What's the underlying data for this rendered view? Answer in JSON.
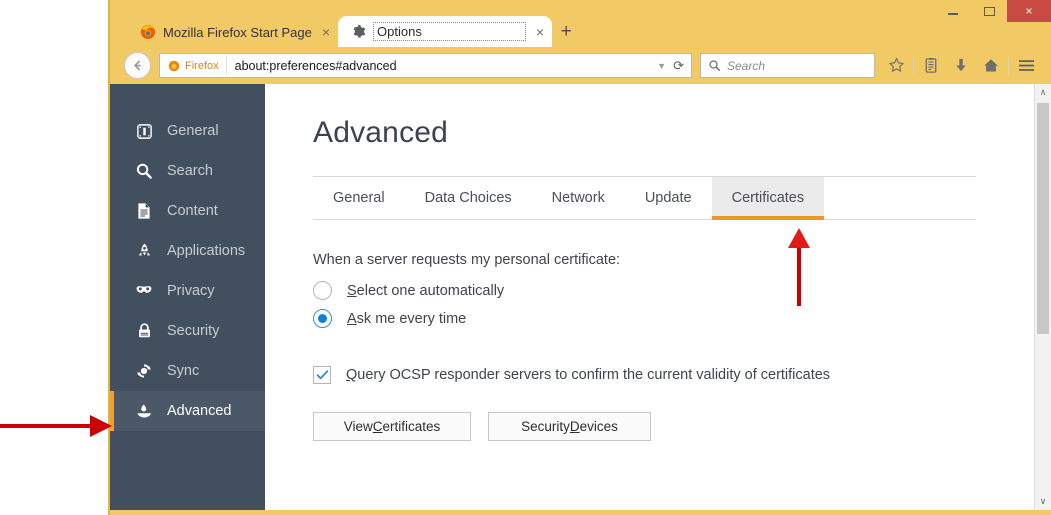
{
  "window": {
    "controls": {
      "minimize_label": "Minimize",
      "maximize_label": "Maximize",
      "close_label": "×"
    }
  },
  "tabs": {
    "items": [
      {
        "title": "Mozilla Firefox Start Page",
        "icon": "firefox-icon",
        "close": "×",
        "active": false
      },
      {
        "title": "Options",
        "icon": "gear-icon",
        "close": "×",
        "active": true
      }
    ],
    "new_tab_label": "+"
  },
  "toolbar": {
    "back_label": "←",
    "identity_label": "Firefox",
    "url": "about:preferences#advanced",
    "dropdown_label": "▼",
    "reload_label": "⟳",
    "search_placeholder": "Search",
    "icons": [
      {
        "name": "bookmark-star-icon",
        "label": "Bookmark"
      },
      {
        "name": "library-icon",
        "label": "Show your bookmarks"
      },
      {
        "name": "downloads-icon",
        "label": "Downloads"
      },
      {
        "name": "home-icon",
        "label": "Home"
      },
      {
        "name": "menu-hamburger-icon",
        "label": "Open menu"
      }
    ]
  },
  "sidebar": {
    "items": [
      {
        "label": "General",
        "icon": "general-panel-icon",
        "selected": false
      },
      {
        "label": "Search",
        "icon": "magnifier-icon",
        "selected": false
      },
      {
        "label": "Content",
        "icon": "document-icon",
        "selected": false
      },
      {
        "label": "Applications",
        "icon": "rocket-icon",
        "selected": false
      },
      {
        "label": "Privacy",
        "icon": "mask-icon",
        "selected": false
      },
      {
        "label": "Security",
        "icon": "padlock-icon",
        "selected": false
      },
      {
        "label": "Sync",
        "icon": "sync-refresh-icon",
        "selected": false
      },
      {
        "label": "Advanced",
        "icon": "flask-icon",
        "selected": true
      }
    ],
    "accent_color": "#f0a030",
    "background_color": "#424f5e"
  },
  "main": {
    "page_title": "Advanced",
    "tabs": [
      {
        "label": "General",
        "selected": false
      },
      {
        "label": "Data Choices",
        "selected": false
      },
      {
        "label": "Network",
        "selected": false
      },
      {
        "label": "Update",
        "selected": false
      },
      {
        "label": "Certificates",
        "selected": true
      }
    ],
    "tab_accent_color": "#e8972a",
    "certificates_pane": {
      "prompt": "When a server requests my personal certificate:",
      "radio_options": [
        {
          "label_pre": "",
          "label_key": "S",
          "label_post": "elect one automatically",
          "selected": false
        },
        {
          "label_pre": "",
          "label_key": "A",
          "label_post": "sk me every time",
          "selected": true
        }
      ],
      "checkbox": {
        "label_key": "Q",
        "label_post": "uery OCSP responder servers to confirm the current validity of certificates",
        "checked": true,
        "check_glyph": "✓"
      },
      "buttons": [
        {
          "label_pre": "View ",
          "label_key": "C",
          "label_post": "ertificates"
        },
        {
          "label_pre": "Security ",
          "label_key": "D",
          "label_post": "evices"
        }
      ]
    }
  },
  "scrollbar": {
    "up_arrow": "∧",
    "down_arrow": "∨"
  },
  "annotations": {
    "color": "#cc0000",
    "arrow_up_target": "Certificates tab",
    "arrow_left_target": "Advanced sidebar item"
  }
}
